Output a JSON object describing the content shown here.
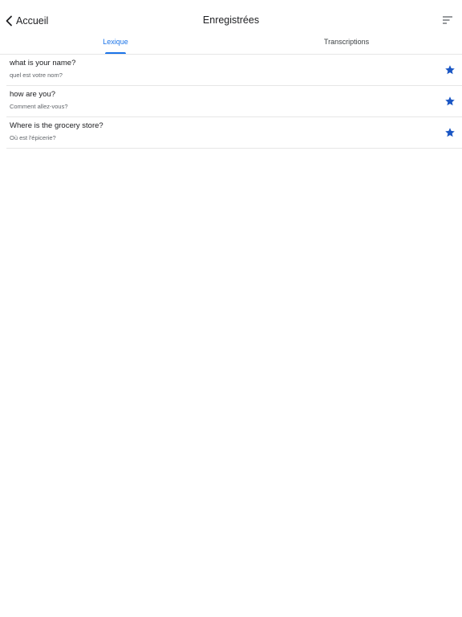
{
  "header": {
    "back_label": "Accueil",
    "title": "Enregistrées",
    "back_icon": "chevron-left-icon",
    "sort_icon": "sort-icon"
  },
  "tabs": [
    {
      "label": "Lexique",
      "active": true
    },
    {
      "label": "Transcriptions",
      "active": false
    }
  ],
  "saved_items": [
    {
      "phrase": "what is your name?",
      "translation": "quel est votre nom?",
      "starred": true
    },
    {
      "phrase": "how are you?",
      "translation": "Comment allez-vous?",
      "starred": true
    },
    {
      "phrase": "Where is the grocery store?",
      "translation": "Où est l'épicerie?",
      "starred": true
    }
  ],
  "colors": {
    "accent": "#1a73e8",
    "star": "#1a56c4",
    "divider": "#e6e6e6"
  }
}
